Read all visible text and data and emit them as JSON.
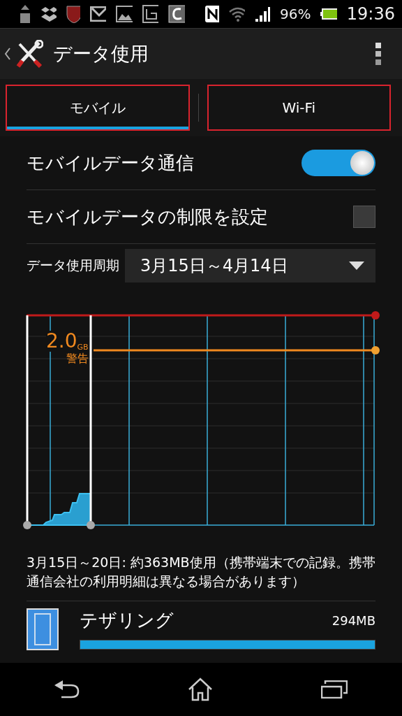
{
  "status_bar": {
    "battery": "96%",
    "time": "19:36"
  },
  "action_bar": {
    "title": "データ使用"
  },
  "tabs": [
    {
      "label": "モバイル",
      "selected": true
    },
    {
      "label": "Wi-Fi",
      "selected": false
    }
  ],
  "settings": [
    {
      "kind": "toggle",
      "label": "モバイルデータ通信",
      "on": true
    },
    {
      "kind": "checkbox",
      "label": "モバイルデータの制限を設定",
      "checked": false
    }
  ],
  "cycle": {
    "label": "データ使用周期",
    "value": "3月15日～4月14日"
  },
  "chart": {
    "warning_value": "2.0",
    "warning_unit": "GB",
    "warning_label": "警告"
  },
  "summary": "3月15日～20日: 約363MB使用（携帯端末での記録。携帯通信会社の利用明細は異なる場合があります）",
  "apps": [
    {
      "name": "テザリング",
      "usage": "294MB",
      "level": 1.0
    }
  ]
}
